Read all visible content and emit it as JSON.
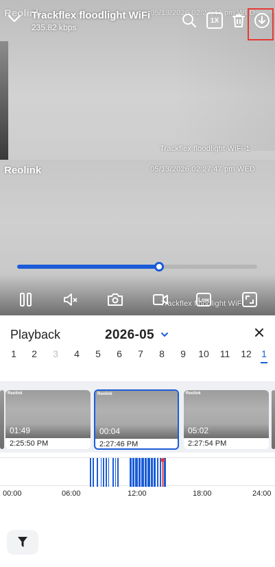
{
  "header": {
    "title": "Trackflex floodlight WiFi",
    "bitrate": "235.82 kbps",
    "speed_label": "1X"
  },
  "video": {
    "brand": "Reolink",
    "top_timestamp": "05/13/2026 02:27:47 pm WED",
    "top_camera_name": "Trackflex floodlight WiFi-1",
    "timestamp": "05/13/2026 02:27:47 pm WED",
    "bottom_camera_name": "Trackflex floodlight WiFi",
    "progress": 0.59,
    "quality_label": "Low"
  },
  "playback": {
    "title": "Playback",
    "date": "2026-05",
    "months": [
      {
        "label": "1",
        "state": "normal"
      },
      {
        "label": "2",
        "state": "normal"
      },
      {
        "label": "3",
        "state": "disabled"
      },
      {
        "label": "4",
        "state": "normal"
      },
      {
        "label": "5",
        "state": "normal"
      },
      {
        "label": "6",
        "state": "normal"
      },
      {
        "label": "7",
        "state": "normal"
      },
      {
        "label": "8",
        "state": "normal"
      },
      {
        "label": "9",
        "state": "normal"
      },
      {
        "label": "10",
        "state": "normal"
      },
      {
        "label": "11",
        "state": "normal"
      },
      {
        "label": "12",
        "state": "normal"
      },
      {
        "label": "1",
        "state": "active"
      }
    ],
    "clips": [
      {
        "duration": "01:49",
        "time": "2:25:50 PM",
        "selected": false
      },
      {
        "duration": "00:04",
        "time": "2:27:46 PM",
        "selected": true
      },
      {
        "duration": "05:02",
        "time": "2:27:54 PM",
        "selected": false
      }
    ],
    "hours": [
      "00:00",
      "06:00",
      "12:00",
      "18:00",
      "24:00"
    ]
  },
  "colors": {
    "accent": "#1a5cd8",
    "highlight": "#e53935",
    "playhead": "#e53935"
  }
}
